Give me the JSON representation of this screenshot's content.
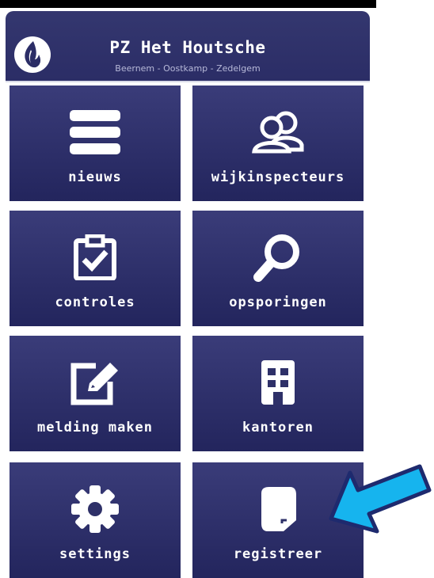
{
  "app": {
    "title": "PZ Het Houtsche",
    "subtitle": "Beernem - Oostkamp - Zedelgem",
    "logo_icon": "police-flame-logo-icon"
  },
  "menu": [
    {
      "id": "nieuws",
      "label": "nieuws",
      "icon": "list-icon"
    },
    {
      "id": "wijkinspecteurs",
      "label": "wijkinspecteurs",
      "icon": "users-icon"
    },
    {
      "id": "controles",
      "label": "controles",
      "icon": "clipboard-check-icon"
    },
    {
      "id": "opsporingen",
      "label": "opsporingen",
      "icon": "search-icon"
    },
    {
      "id": "melding-maken",
      "label": "melding maken",
      "icon": "edit-icon"
    },
    {
      "id": "kantoren",
      "label": "kantoren",
      "icon": "building-icon"
    },
    {
      "id": "settings",
      "label": "settings",
      "icon": "gear-icon"
    },
    {
      "id": "registreer",
      "label": "registreer",
      "icon": "document-icon"
    }
  ],
  "colors": {
    "tile": "#2e3068",
    "header": "#2f3169",
    "arrow": "#16b4ee",
    "arrow_outline": "#1e2a6e"
  }
}
